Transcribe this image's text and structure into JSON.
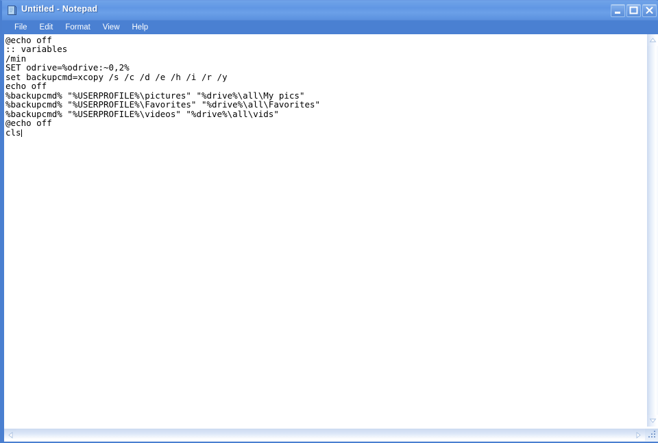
{
  "window": {
    "title": "Untitled - Notepad",
    "icon": "notepad-icon",
    "titlebar_color": "#6197e4",
    "menubar_color": "#4a80d2",
    "border_color": "#4a7fd0"
  },
  "window_controls": [
    {
      "name": "minimize",
      "glyph": "minimize-icon",
      "label": "Minimize"
    },
    {
      "name": "maximize",
      "glyph": "maximize-icon",
      "label": "Maximize"
    },
    {
      "name": "close",
      "glyph": "close-icon",
      "label": "Close"
    }
  ],
  "menu": {
    "items": [
      {
        "label": "File"
      },
      {
        "label": "Edit"
      },
      {
        "label": "Format"
      },
      {
        "label": "View"
      },
      {
        "label": "Help"
      }
    ]
  },
  "editor": {
    "lines": [
      "@echo off",
      ":: variables",
      "/min",
      "SET odrive=%odrive:~0,2%",
      "set backupcmd=xcopy /s /c /d /e /h /i /r /y",
      "echo off",
      "%backupcmd% \"%USERPROFILE%\\pictures\" \"%drive%\\all\\My pics\"",
      "%backupcmd% \"%USERPROFILE%\\Favorites\" \"%drive%\\all\\Favorites\"",
      "%backupcmd% \"%USERPROFILE%\\videos\" \"%drive%\\all\\vids\"",
      "@echo off",
      "cls"
    ],
    "text_color": "#000000",
    "background_color": "#ffffff",
    "caret_after_line": 11
  },
  "scrollbars": {
    "vertical": {
      "up_arrow": "scroll-up-icon",
      "down_arrow": "scroll-down-icon",
      "thumb_visible": false
    },
    "horizontal": {
      "left_arrow": "scroll-left-icon",
      "right_arrow": "scroll-right-icon",
      "thumb_visible": false
    },
    "resize_grip": "resize-grip-icon"
  }
}
